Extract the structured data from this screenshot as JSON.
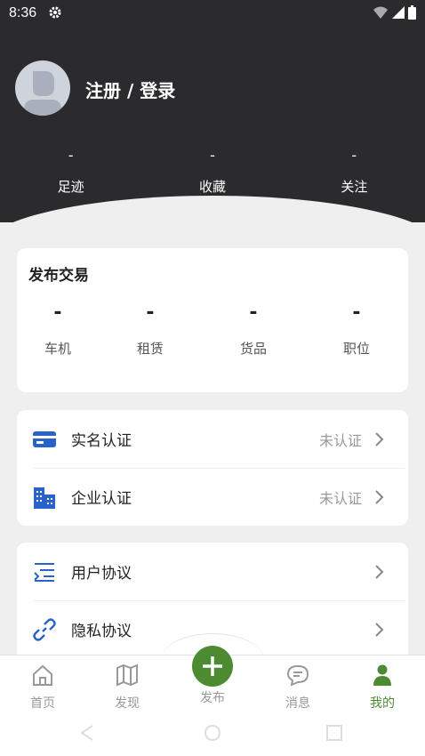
{
  "status_bar": {
    "time": "8:36"
  },
  "profile": {
    "login_text": "注册 / 登录"
  },
  "stats": [
    {
      "value": "-",
      "label": "足迹"
    },
    {
      "value": "-",
      "label": "收藏"
    },
    {
      "value": "-",
      "label": "关注"
    }
  ],
  "trade": {
    "title": "发布交易",
    "items": [
      {
        "value": "-",
        "label": "车机"
      },
      {
        "value": "-",
        "label": "租赁"
      },
      {
        "value": "-",
        "label": "货品"
      },
      {
        "value": "-",
        "label": "职位"
      }
    ]
  },
  "certification": [
    {
      "label": "实名认证",
      "status": "未认证",
      "icon": "id-card-icon"
    },
    {
      "label": "企业认证",
      "status": "未认证",
      "icon": "building-icon"
    }
  ],
  "agreements": [
    {
      "label": "用户协议",
      "icon": "list-icon"
    },
    {
      "label": "隐私协议",
      "icon": "link-icon"
    }
  ],
  "tabs": [
    {
      "label": "首页",
      "icon": "home-icon"
    },
    {
      "label": "发现",
      "icon": "map-icon"
    },
    {
      "label": "发布",
      "icon": "plus-icon"
    },
    {
      "label": "消息",
      "icon": "message-icon"
    },
    {
      "label": "我的",
      "icon": "person-icon",
      "active": true
    }
  ],
  "colors": {
    "accent": "#4d8b33",
    "header_bg": "#2b2b2d",
    "icon_blue": "#2962c9"
  }
}
